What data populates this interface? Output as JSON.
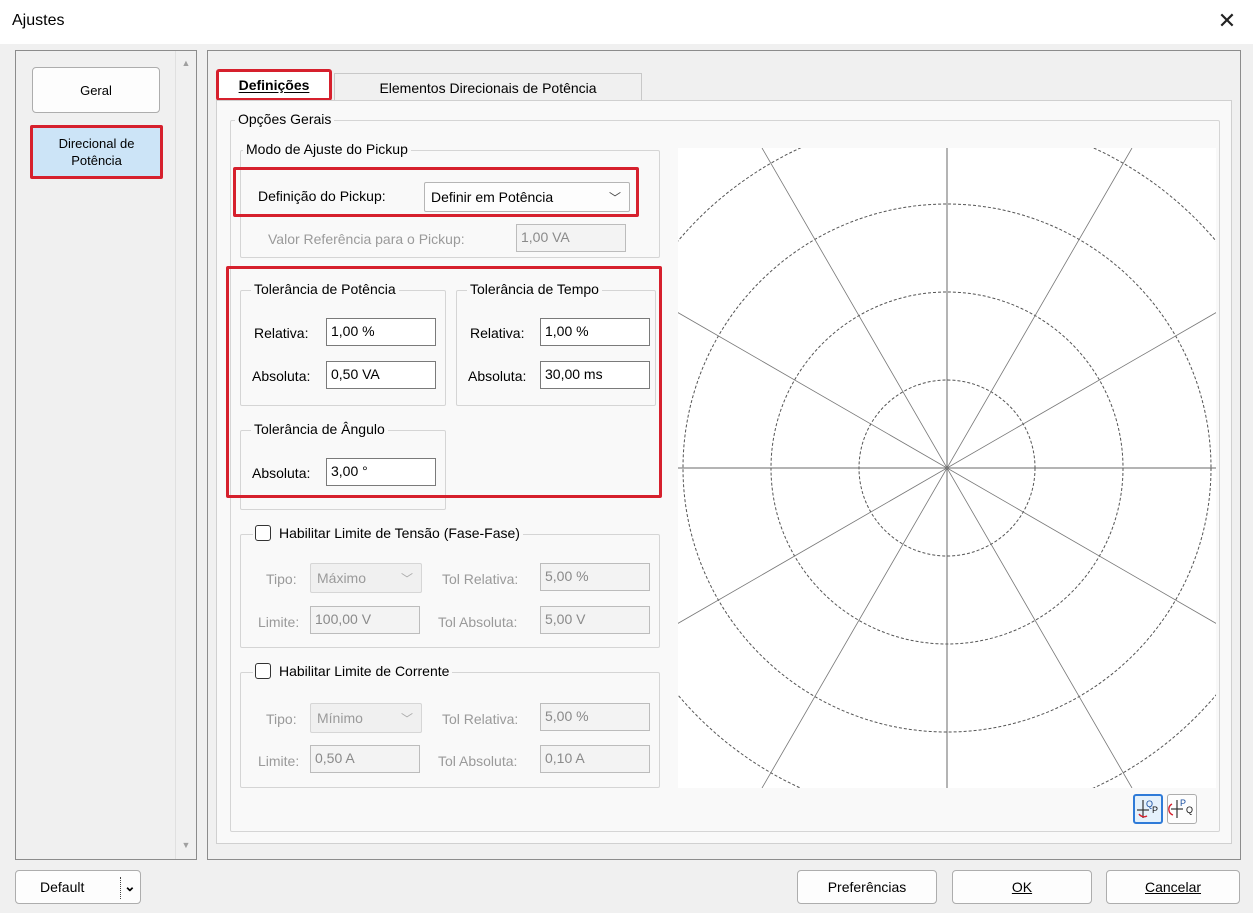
{
  "window": {
    "title": "Ajustes",
    "close_glyph": "✕"
  },
  "nav": {
    "geral": "Geral",
    "direcional_line1": "Direcional de",
    "direcional_line2": "Potência"
  },
  "tabs": {
    "definicoes": "Definições",
    "elementos": "Elementos Direcionais de Potência"
  },
  "opcoes_gerais": {
    "legend": "Opções Gerais"
  },
  "pickup": {
    "legend": "Modo de Ajuste do Pickup",
    "definicao_label": "Definição do Pickup:",
    "definicao_value": "Definir em Potência",
    "valor_ref_label": "Valor Referência para o Pickup:",
    "valor_ref_value": "1,00 VA"
  },
  "tol_potencia": {
    "legend": "Tolerância de Potência",
    "relativa_label": "Relativa:",
    "relativa_value": "1,00 %",
    "absoluta_label": "Absoluta:",
    "absoluta_value": "0,50 VA"
  },
  "tol_tempo": {
    "legend": "Tolerância de Tempo",
    "relativa_label": "Relativa:",
    "relativa_value": "1,00 %",
    "absoluta_label": "Absoluta:",
    "absoluta_value": "30,00 ms"
  },
  "tol_angulo": {
    "legend": "Tolerância de Ângulo",
    "absoluta_label": "Absoluta:",
    "absoluta_value": "3,00 °"
  },
  "lim_tensao": {
    "legend": "Habilitar Limite de Tensão (Fase-Fase)",
    "checked": false,
    "tipo_label": "Tipo:",
    "tipo_value": "Máximo",
    "tol_rel_label": "Tol Relativa:",
    "tol_rel_value": "5,00 %",
    "limite_label": "Limite:",
    "limite_value": "100,00 V",
    "tol_abs_label": "Tol Absoluta:",
    "tol_abs_value": "5,00 V"
  },
  "lim_corrente": {
    "legend": "Habilitar Limite de Corrente",
    "checked": false,
    "tipo_label": "Tipo:",
    "tipo_value": "Mínimo",
    "tol_rel_label": "Tol Relativa:",
    "tol_rel_value": "5,00 %",
    "limite_label": "Limite:",
    "limite_value": "0,50 A",
    "tol_abs_label": "Tol Absoluta:",
    "tol_abs_value": "0,10 A"
  },
  "plot_buttons": {
    "qp_icon": "axes-q-p-icon",
    "pq_icon": "axes-p-q-icon",
    "qp_active": true
  },
  "footer": {
    "default": "Default",
    "preferencias": "Preferências",
    "ok": "OK",
    "cancelar": "Cancelar"
  },
  "colors": {
    "highlight_red": "#d6202d",
    "selected_blue": "#cce4f7",
    "active_border": "#2f7bd8"
  }
}
